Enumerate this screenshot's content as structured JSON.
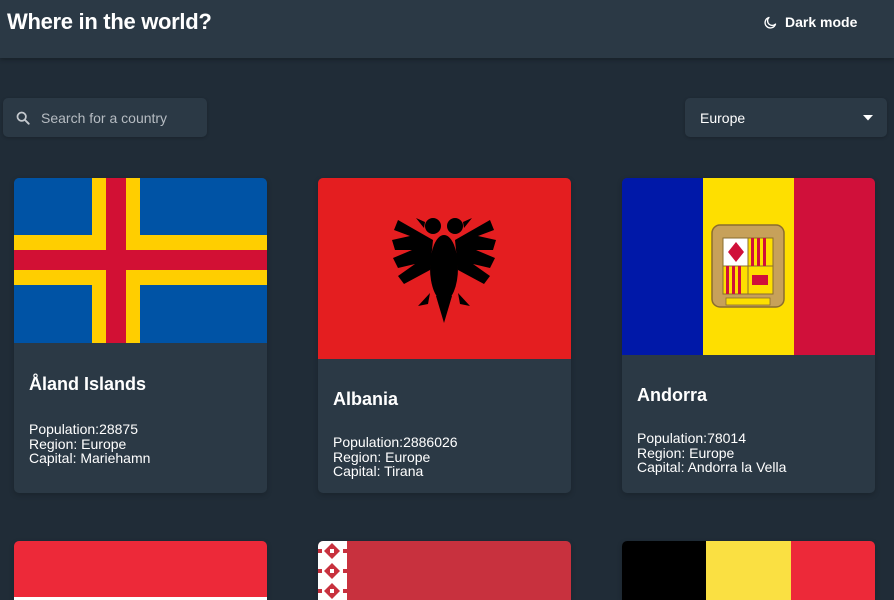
{
  "header": {
    "title": "Where in the world?",
    "dark_mode_label": "Dark mode"
  },
  "search": {
    "placeholder": "Search for a country"
  },
  "filter": {
    "selected": "Europe"
  },
  "colors": {
    "background": "#202c37",
    "element": "#2b3945",
    "text": "#ffffff"
  },
  "countries": [
    {
      "name": "Åland Islands",
      "population_label": "Population:",
      "population": "28875",
      "region_label": "Region: ",
      "region": "Europe",
      "capital_label": "Capital: ",
      "capital": "Mariehamn"
    },
    {
      "name": "Albania",
      "population_label": "Population:",
      "population": "2886026",
      "region_label": "Region: ",
      "region": "Europe",
      "capital_label": "Capital: ",
      "capital": "Tirana"
    },
    {
      "name": "Andorra",
      "population_label": "Population:",
      "population": "78014",
      "region_label": "Region: ",
      "region": "Europe",
      "capital_label": "Capital: ",
      "capital": "Andorra la Vella"
    }
  ]
}
